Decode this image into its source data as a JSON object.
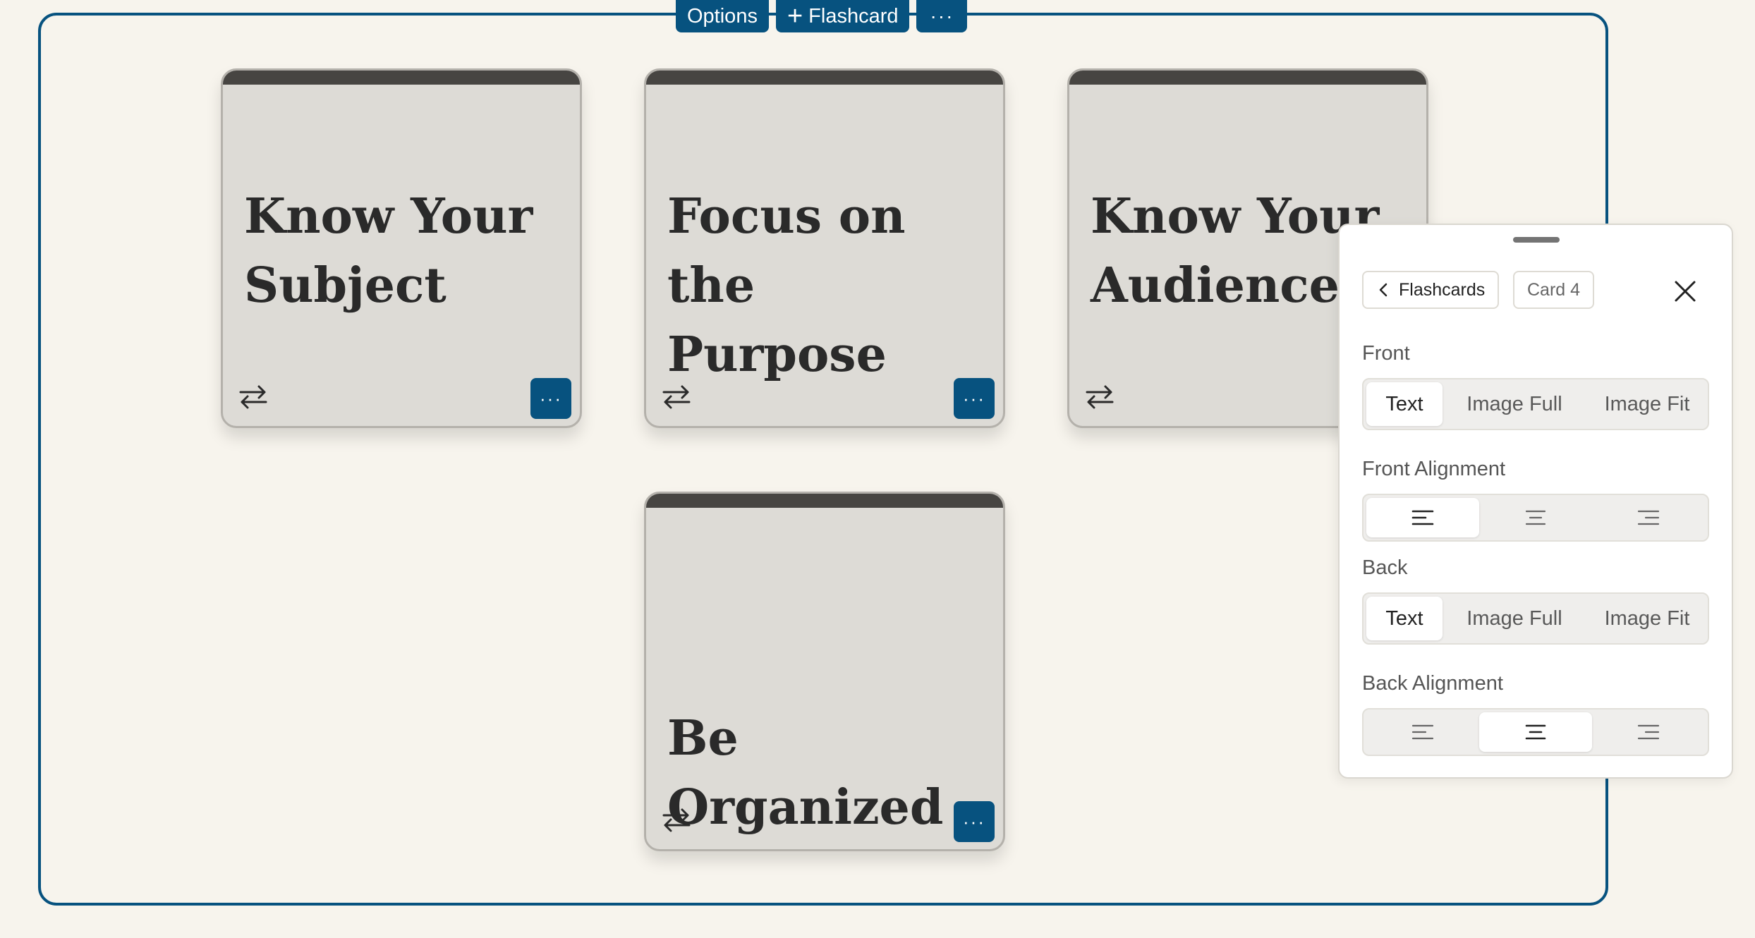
{
  "toolbar": {
    "options_label": "Options",
    "add_label": "Flashcard",
    "more_label": "···"
  },
  "cards": [
    {
      "title": "Know Your\nSubject",
      "menu_label": "···"
    },
    {
      "title": "Focus on the\nPurpose",
      "menu_label": "···"
    },
    {
      "title": "Know Your\nAudience",
      "menu_label": "···"
    },
    {
      "title": "Be Organized",
      "menu_label": "···"
    }
  ],
  "panel": {
    "breadcrumb_back": "Flashcards",
    "breadcrumb_current": "Card 4",
    "front_label": "Front",
    "front_options": [
      "Text",
      "Image Full",
      "Image Fit"
    ],
    "front_selected": "Text",
    "front_alignment_label": "Front Alignment",
    "front_alignment_selected": "left",
    "back_label": "Back",
    "back_options": [
      "Text",
      "Image Full",
      "Image Fit"
    ],
    "back_selected": "Text",
    "back_alignment_label": "Back Alignment",
    "back_alignment_selected": "center"
  },
  "colors": {
    "accent": "#07527f",
    "background": "#f7f4ed",
    "card": "#dddbd6",
    "card_header": "#474542"
  },
  "icons": [
    "plus-icon",
    "swap-icon",
    "chevron-left-icon",
    "close-icon",
    "align-left-icon",
    "align-center-icon",
    "align-right-icon"
  ]
}
